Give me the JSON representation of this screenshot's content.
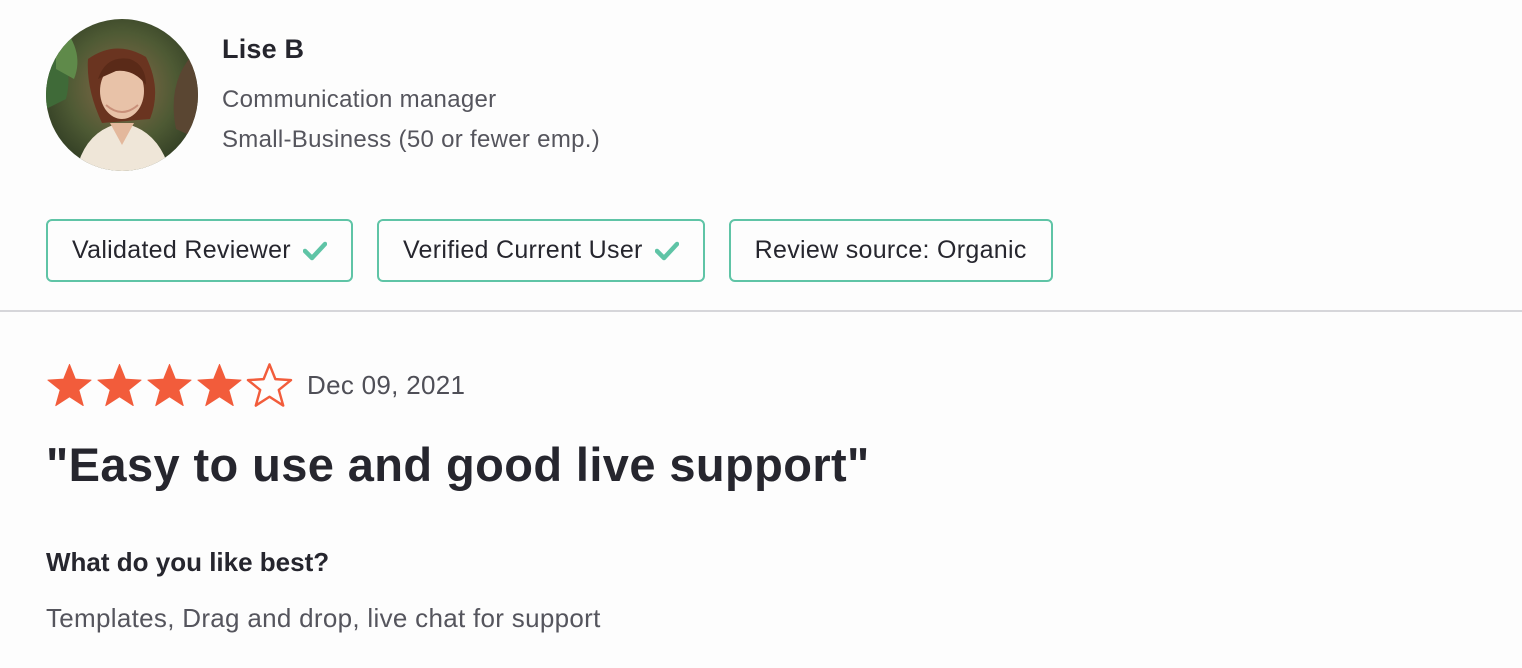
{
  "reviewer": {
    "name": "Lise B",
    "role": "Communication manager",
    "segment": "Small-Business (50 or fewer emp.)",
    "avatar_icon": "reviewer-avatar-photo"
  },
  "badges": [
    {
      "label": "Validated Reviewer",
      "icon": "check-icon"
    },
    {
      "label": "Verified Current User",
      "icon": "check-icon"
    },
    {
      "label": "Review source: Organic"
    }
  ],
  "review": {
    "rating": 4,
    "rating_max": 5,
    "date": "Dec 09, 2021",
    "title": "\"Easy to use and good live support\"",
    "question": "What do you like best?",
    "answer": "Templates, Drag and drop, live chat for support"
  },
  "colors": {
    "star": "#f25c3b",
    "badge_border": "#5fc4a6",
    "check": "#5fc4a6",
    "divider": "#d6d6da"
  }
}
